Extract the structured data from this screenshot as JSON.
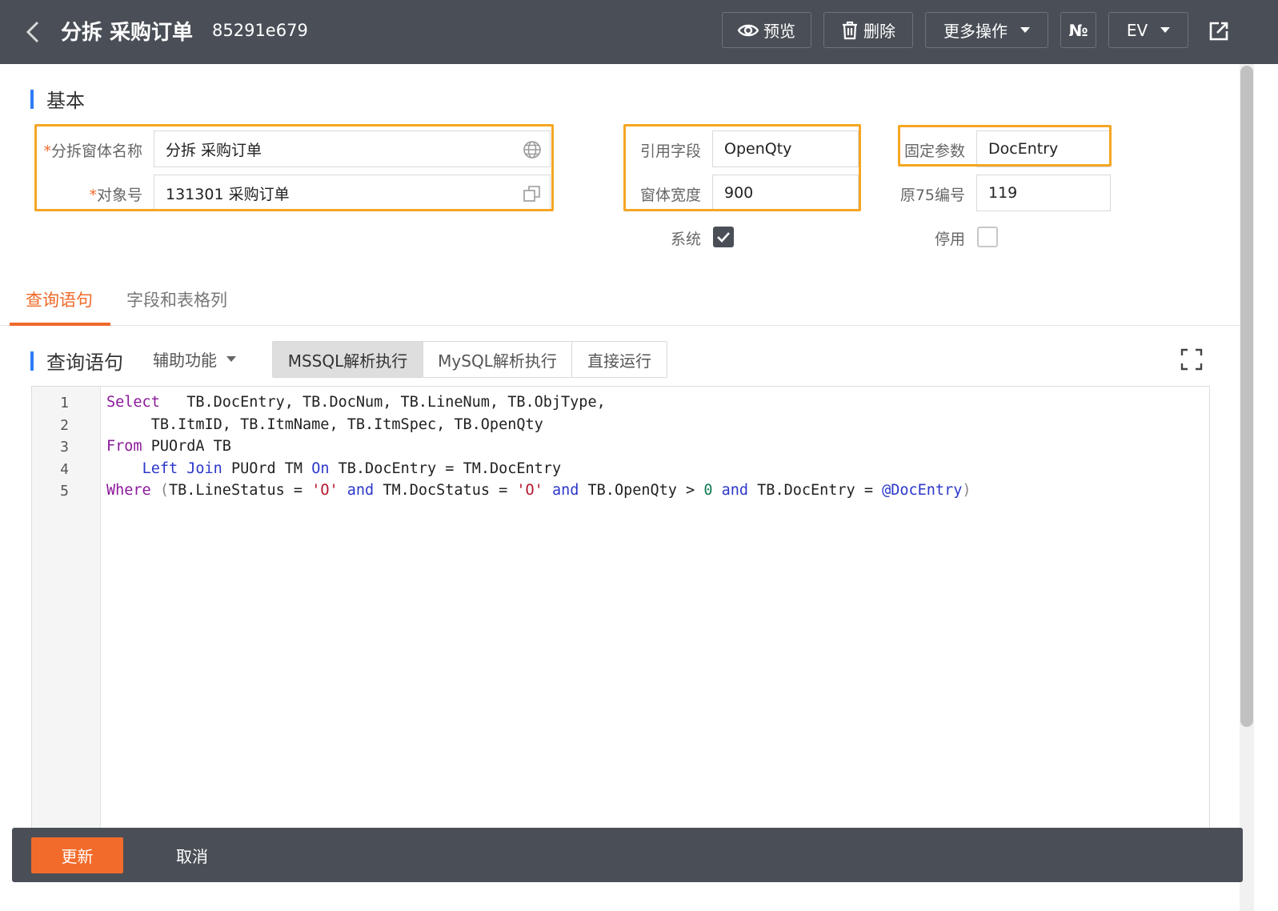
{
  "header": {
    "title": "分拆 采购订单",
    "doc_id": "85291e679",
    "preview_label": "预览",
    "delete_label": "删除",
    "more_label": "更多操作",
    "numbering_label": "№",
    "env_label": "EV"
  },
  "basic": {
    "section_title": "基本",
    "split_form_name": {
      "label": "分拆窗体名称",
      "value": "分拆 采购订单"
    },
    "object_no": {
      "label": "对象号",
      "value": "131301 采购订单"
    },
    "ref_field": {
      "label": "引用字段",
      "value": "OpenQty"
    },
    "form_width": {
      "label": "窗体宽度",
      "value": "900"
    },
    "fixed_param": {
      "label": "固定参数",
      "value": "DocEntry"
    },
    "orig75_no": {
      "label": "原75编号",
      "value": "119"
    },
    "system": {
      "label": "系统",
      "checked": true
    },
    "disabled": {
      "label": "停用",
      "checked": false
    }
  },
  "tabs": [
    {
      "label": "查询语句",
      "active": true
    },
    {
      "label": "字段和表格列",
      "active": false
    }
  ],
  "query": {
    "section_title": "查询语句",
    "assist_label": "辅助功能",
    "modes": [
      {
        "label": "MSSQL解析执行",
        "active": true
      },
      {
        "label": "MySQL解析执行",
        "active": false
      },
      {
        "label": "直接运行",
        "active": false
      }
    ],
    "line_numbers": [
      "1",
      "2",
      "3",
      "4",
      "5"
    ],
    "code_lines": [
      "Select   TB.DocEntry, TB.DocNum, TB.LineNum, TB.ObjType,",
      "     TB.ItmID, TB.ItmName, TB.ItmSpec, TB.OpenQty",
      "From PUOrdA TB",
      "    Left Join PUOrd TM On TB.DocEntry = TM.DocEntry",
      "Where (TB.LineStatus = 'O' and TM.DocStatus = 'O' and TB.OpenQty > 0 and TB.DocEntry = @DocEntry)"
    ]
  },
  "footer": {
    "update_label": "更新",
    "cancel_label": "取消"
  },
  "colors": {
    "header_bg": "#4a4f57",
    "accent_orange": "#f06a2a",
    "highlight_border": "#f5a623",
    "section_bar_blue": "#2e7cf6"
  }
}
